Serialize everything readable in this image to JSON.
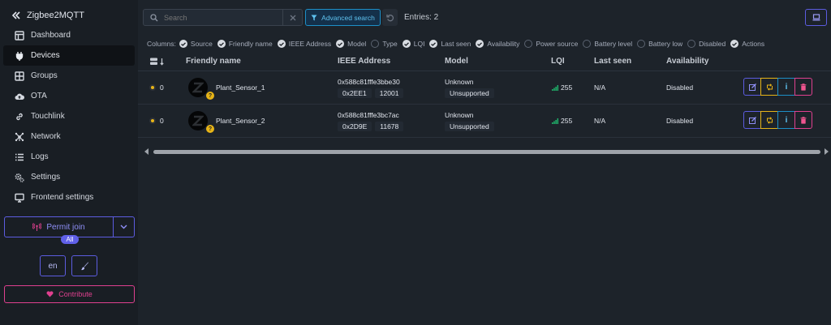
{
  "app": {
    "title": "Zigbee2MQTT"
  },
  "sidebar": {
    "items": [
      {
        "label": "Dashboard",
        "icon": "dashboard-icon"
      },
      {
        "label": "Devices",
        "icon": "plug-icon",
        "active": true
      },
      {
        "label": "Groups",
        "icon": "grid-icon"
      },
      {
        "label": "OTA",
        "icon": "cloud-upload-icon"
      },
      {
        "label": "Touchlink",
        "icon": "link-icon"
      },
      {
        "label": "Network",
        "icon": "network-icon"
      },
      {
        "label": "Logs",
        "icon": "list-icon"
      },
      {
        "label": "Settings",
        "icon": "cogs-icon"
      },
      {
        "label": "Frontend settings",
        "icon": "monitor-icon"
      }
    ],
    "permit_join": {
      "label": "Permit join",
      "badge": "All"
    },
    "language": "en",
    "contribute": "Contribute"
  },
  "toolbar": {
    "search_placeholder": "Search",
    "advanced_search": "Advanced search",
    "entries": "Entries: 2"
  },
  "columns_bar": {
    "label": "Columns:",
    "options": [
      {
        "label": "Source",
        "checked": true
      },
      {
        "label": "Friendly name",
        "checked": true
      },
      {
        "label": "IEEE Address",
        "checked": true
      },
      {
        "label": "Model",
        "checked": true
      },
      {
        "label": "Type",
        "checked": false
      },
      {
        "label": "LQI",
        "checked": true
      },
      {
        "label": "Last seen",
        "checked": true
      },
      {
        "label": "Availability",
        "checked": true
      },
      {
        "label": "Power source",
        "checked": false
      },
      {
        "label": "Battery level",
        "checked": false
      },
      {
        "label": "Battery low",
        "checked": false
      },
      {
        "label": "Disabled",
        "checked": false
      },
      {
        "label": "Actions",
        "checked": true
      }
    ]
  },
  "table": {
    "headers": {
      "friendly_name": "Friendly name",
      "ieee": "IEEE Address",
      "model": "Model",
      "lqi": "LQI",
      "last_seen": "Last seen",
      "availability": "Availability"
    },
    "rows": [
      {
        "source": "0",
        "name": "Plant_Sensor_1",
        "ieee": "0x588c81fffe3bbe30",
        "nwk_hex": "0x2EE1",
        "nwk_dec": "12001",
        "model": "Unknown",
        "support": "Unsupported",
        "lqi": "255",
        "last_seen": "N/A",
        "availability": "Disabled"
      },
      {
        "source": "0",
        "name": "Plant_Sensor_2",
        "ieee": "0x588c81fffe3bc7ac",
        "nwk_hex": "0x2D9E",
        "nwk_dec": "11678",
        "model": "Unknown",
        "support": "Unsupported",
        "lqi": "255",
        "last_seen": "N/A",
        "availability": "Disabled"
      }
    ]
  },
  "colors": {
    "accent": "#5c5ce0",
    "info": "#1d8fc7",
    "warning": "#e7b417",
    "danger": "#e0408f",
    "success": "#1fb86d"
  }
}
